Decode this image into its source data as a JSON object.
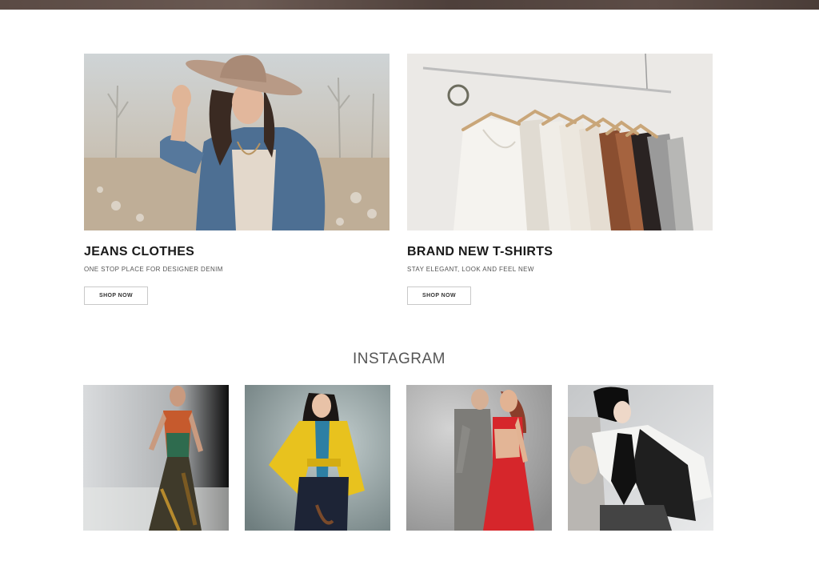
{
  "promos": [
    {
      "title": "JEANS CLOTHES",
      "subtitle": "ONE STOP PLACE FOR DESIGNER DENIM",
      "button_label": "SHOP NOW",
      "image": "woman-in-hat-denim-jacket-photo"
    },
    {
      "title": "BRAND NEW T-SHIRTS",
      "subtitle": "STAY ELEGANT, LOOK AND FEEL NEW",
      "button_label": "SHOP NOW",
      "image": "clothes-rack-hangers-photo"
    }
  ],
  "instagram": {
    "heading": "INSTAGRAM",
    "posts": [
      {
        "image": "runway-model-dress-photo"
      },
      {
        "image": "model-yellow-coat-photo"
      },
      {
        "image": "couple-red-dress-photo"
      },
      {
        "image": "model-black-white-outfit-photo"
      }
    ]
  },
  "colors": {
    "background": "#ffffff",
    "top_strip": "#5a4a44",
    "button_border": "#c9c9c9",
    "heading_text": "#555555"
  }
}
